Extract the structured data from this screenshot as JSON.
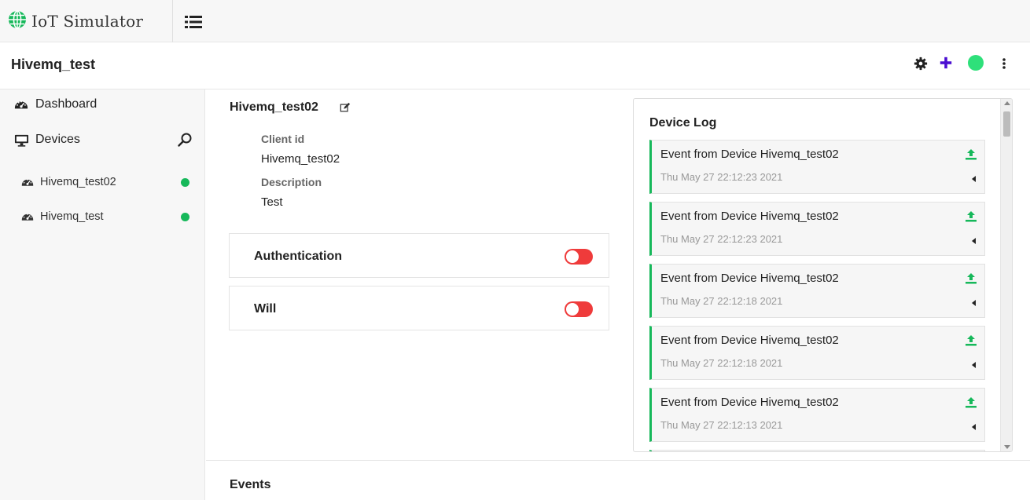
{
  "app": {
    "name": "IoT Simulator"
  },
  "header": {
    "title": "Hivemq_test"
  },
  "colors": {
    "accent_green": "#16b85a",
    "status_green": "#2ee07a",
    "toggle_off_red": "#ef3b3b",
    "plus_purple": "#4b0fd1"
  },
  "sidebar": {
    "dashboard_label": "Dashboard",
    "devices_label": "Devices",
    "devices": [
      {
        "name": "Hivemq_test02",
        "status": "online"
      },
      {
        "name": "Hivemq_test",
        "status": "online"
      }
    ]
  },
  "device": {
    "title": "Hivemq_test02",
    "client_id_label": "Client id",
    "client_id": "Hivemq_test02",
    "description_label": "Description",
    "description": "Test"
  },
  "panels": {
    "authentication": {
      "label": "Authentication",
      "enabled": false
    },
    "will": {
      "label": "Will",
      "enabled": false
    }
  },
  "log": {
    "title": "Device Log",
    "entries": [
      {
        "title": "Event from Device Hivemq_test02",
        "time": "Thu May 27 22:12:23 2021"
      },
      {
        "title": "Event from Device Hivemq_test02",
        "time": "Thu May 27 22:12:23 2021"
      },
      {
        "title": "Event from Device Hivemq_test02",
        "time": "Thu May 27 22:12:18 2021"
      },
      {
        "title": "Event from Device Hivemq_test02",
        "time": "Thu May 27 22:12:18 2021"
      },
      {
        "title": "Event from Device Hivemq_test02",
        "time": "Thu May 27 22:12:13 2021"
      }
    ]
  },
  "events": {
    "title": "Events"
  }
}
